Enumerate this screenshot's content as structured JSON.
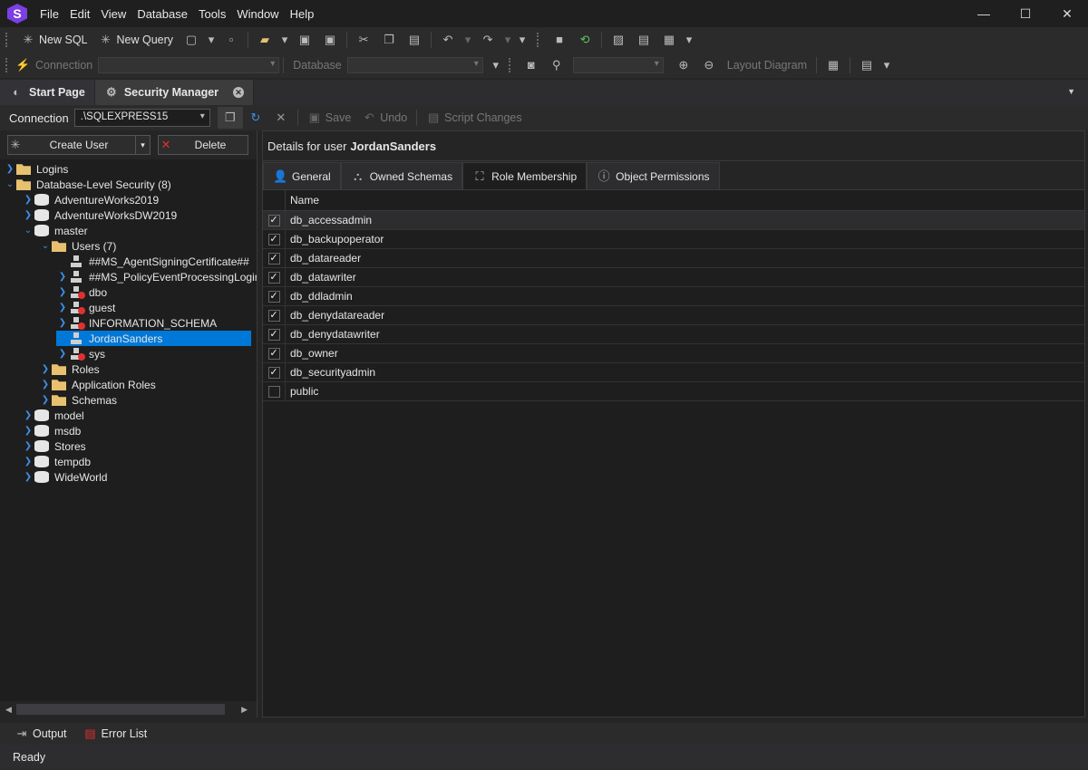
{
  "menu": [
    "File",
    "Edit",
    "View",
    "Database",
    "Tools",
    "Window",
    "Help"
  ],
  "toolbar1": {
    "new_sql": "New SQL",
    "new_query": "New Query"
  },
  "toolbar2": {
    "connection": "Connection",
    "database": "Database",
    "layout_diagram": "Layout Diagram"
  },
  "tabs": [
    {
      "label": "Start Page"
    },
    {
      "label": "Security Manager"
    }
  ],
  "connection": {
    "label": "Connection",
    "value": ".\\SQLEXPRESS15",
    "save": "Save",
    "undo": "Undo",
    "script_changes": "Script Changes"
  },
  "left": {
    "create_user": "Create User",
    "delete": "Delete"
  },
  "tree": [
    "Logins",
    "Database-Level Security  (8)",
    "AdventureWorks2019",
    "AdventureWorksDW2019",
    "master",
    "Users (7)",
    "##MS_AgentSigningCertificate##",
    "##MS_PolicyEventProcessingLogin#",
    "dbo",
    "guest",
    "INFORMATION_SCHEMA",
    "JordanSanders",
    "sys",
    "Roles",
    "Application Roles",
    "Schemas",
    "model",
    "msdb",
    "Stores",
    "tempdb",
    "WideWorld"
  ],
  "details": {
    "prefix": "Details for user",
    "user": "JordanSanders"
  },
  "right_tabs": [
    "General",
    "Owned Schemas",
    "Role Membership",
    "Object Permissions"
  ],
  "grid": {
    "header": "Name",
    "rows": [
      {
        "name": "db_accessadmin",
        "checked": true
      },
      {
        "name": "db_backupoperator",
        "checked": true
      },
      {
        "name": "db_datareader",
        "checked": true
      },
      {
        "name": "db_datawriter",
        "checked": true
      },
      {
        "name": "db_ddladmin",
        "checked": true
      },
      {
        "name": "db_denydatareader",
        "checked": true
      },
      {
        "name": "db_denydatawriter",
        "checked": true
      },
      {
        "name": "db_owner",
        "checked": true
      },
      {
        "name": "db_securityadmin",
        "checked": true
      },
      {
        "name": "public",
        "checked": false
      }
    ]
  },
  "bottom": {
    "output": "Output",
    "error_list": "Error List"
  },
  "status": "Ready"
}
